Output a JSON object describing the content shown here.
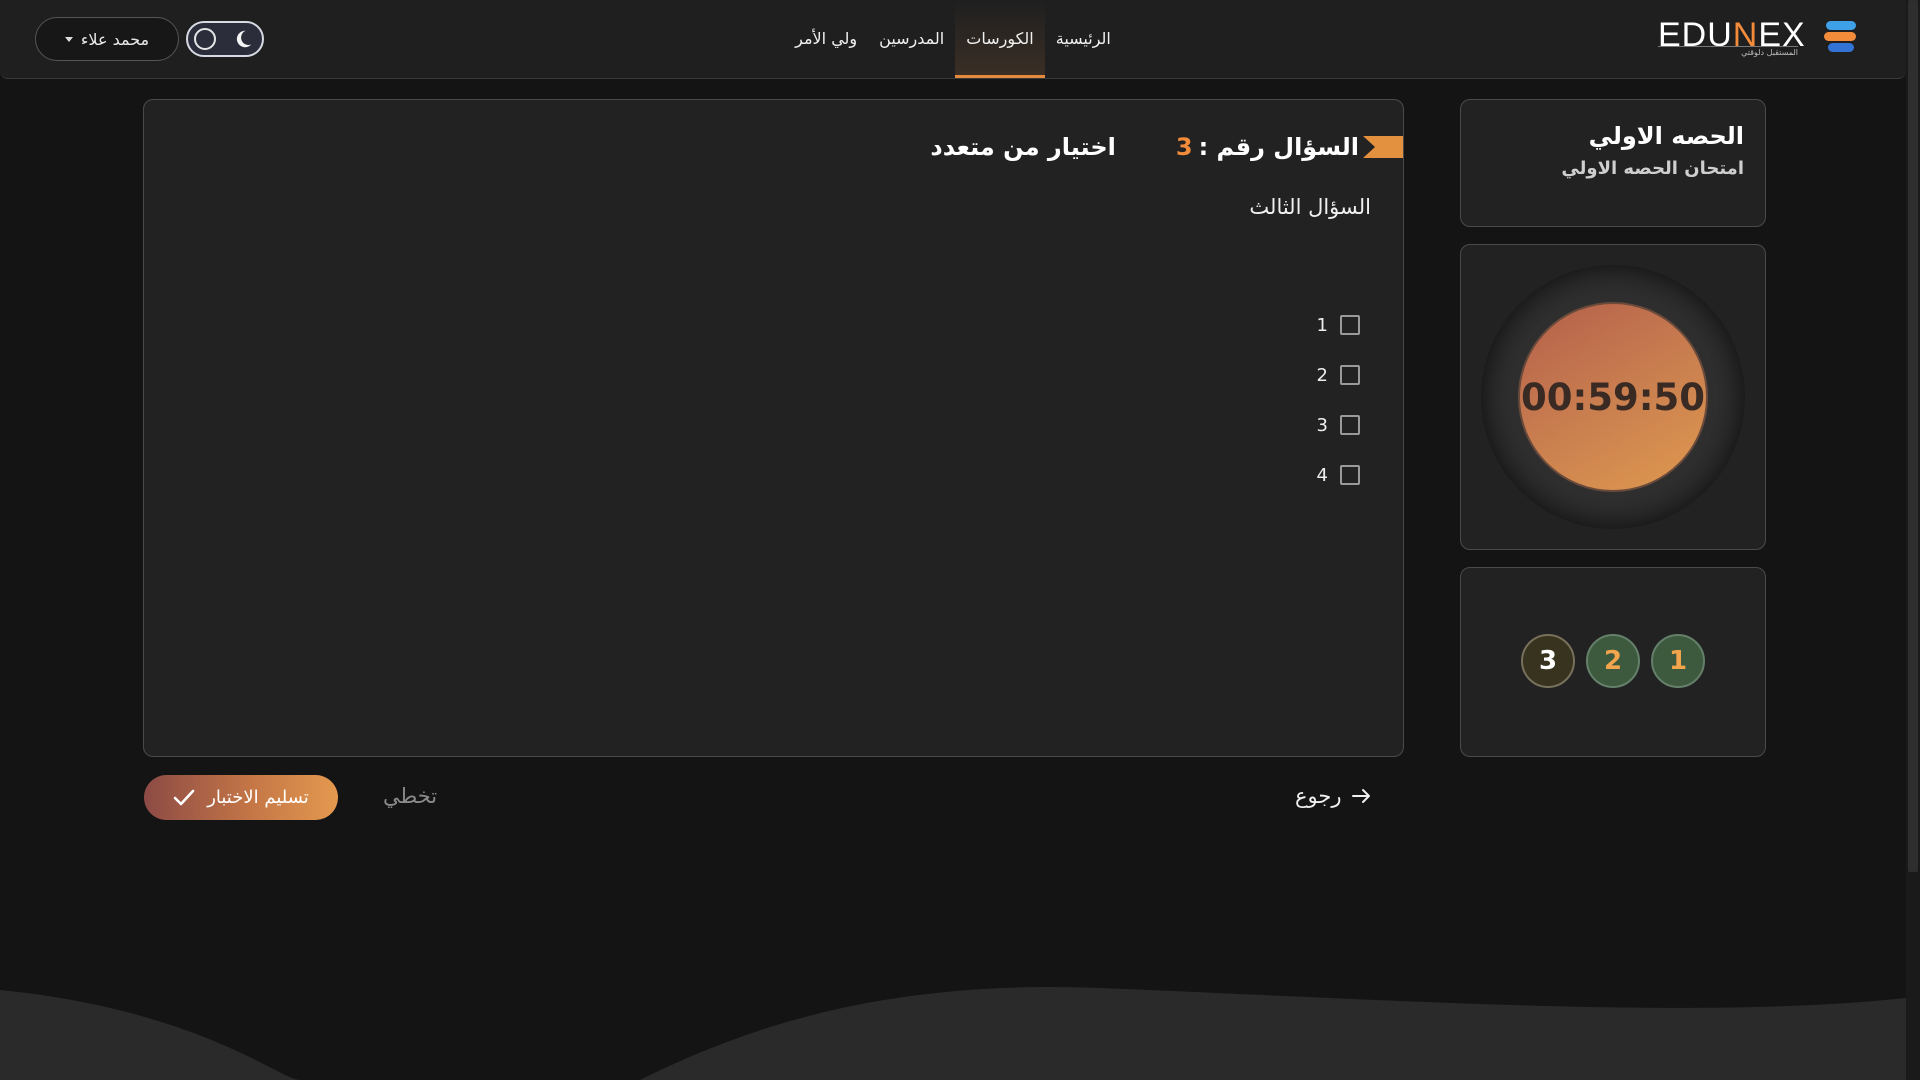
{
  "brand": {
    "logo_text_left": "EDU",
    "logo_text_n": "N",
    "logo_text_right": "EX",
    "tagline": "المستقبل دلوقتي"
  },
  "nav": {
    "links": [
      {
        "label": "الرئيسية"
      },
      {
        "label": "الكورسات",
        "active": true
      },
      {
        "label": "المدرسين"
      },
      {
        "label": "ولي الأمر"
      }
    ],
    "user_name": "محمد علاء",
    "theme_icon": "moon-icon"
  },
  "lesson": {
    "title": "الحصه الاولي",
    "exam_name": "امتحان الحصه الاولي"
  },
  "timer": {
    "remaining": "00:59:50"
  },
  "question_nav": [
    {
      "label": "1",
      "state": "answered"
    },
    {
      "label": "2",
      "state": "answered"
    },
    {
      "label": "3",
      "state": "current"
    }
  ],
  "question": {
    "label": "السؤال رقم :",
    "number": "3",
    "type": "اختيار من متعدد",
    "text": "السؤال الثالث",
    "options": [
      {
        "label": "1",
        "checked": false
      },
      {
        "label": "2",
        "checked": false
      },
      {
        "label": "3",
        "checked": false
      },
      {
        "label": "4",
        "checked": false
      }
    ]
  },
  "actions": {
    "back": "رجوع",
    "skip": "تخطي",
    "submit": "تسليم الاختبار"
  },
  "colors": {
    "accent": "#f28b3a",
    "background": "#141414",
    "card": "#222222"
  }
}
